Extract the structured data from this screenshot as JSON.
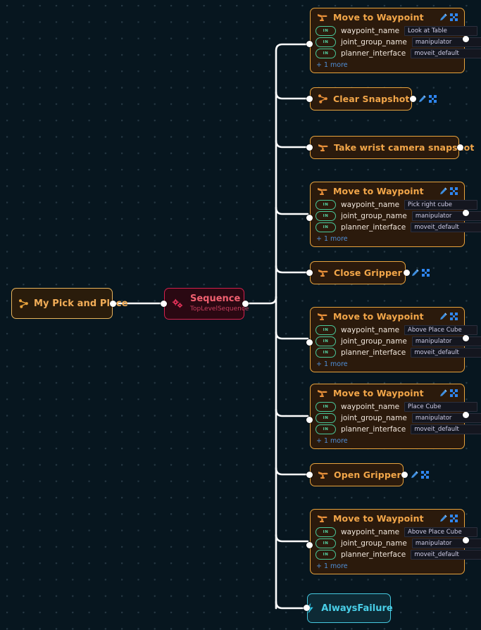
{
  "canvas": {
    "background_color": "#07161f",
    "grid_dot_color": "#96b4c8",
    "edge_color": "#ffffff"
  },
  "icons": {
    "robot_arm": "robot-arm-icon",
    "branch": "branch-node-icon",
    "edit": "pencil-edit-icon",
    "expand": "expand-fullscreen-icon",
    "gears": "double-gear-icon",
    "bolt": "lightning-bolt-icon"
  },
  "port_badge_label": "IN",
  "more_label": "+ 1 more",
  "root": {
    "title": "My Pick and Place",
    "icon": "branch-node-icon",
    "border_color": "#e8b45c"
  },
  "sequence": {
    "title": "Sequence",
    "subtitle": "TopLevelSequence",
    "icon": "double-gear-icon",
    "border_color": "#d4214d"
  },
  "nodes": [
    {
      "id": "move-to-waypoint-look-at-table",
      "type": "action",
      "title": "Move to Waypoint",
      "icon": "robot-arm-icon",
      "ports": [
        {
          "direction": "IN",
          "name": "waypoint_name",
          "value": "Look at Table"
        },
        {
          "direction": "IN",
          "name": "joint_group_name",
          "value": "manipulator"
        },
        {
          "direction": "IN",
          "name": "planner_interface",
          "value": "moveit_default"
        }
      ],
      "more": "+ 1 more"
    },
    {
      "id": "clear-snapshot",
      "type": "action-compact",
      "title": "Clear Snapshot",
      "icon": "branch-node-icon",
      "ports": [],
      "more": null
    },
    {
      "id": "take-wrist-camera-snapshot",
      "type": "action-compact",
      "title": "Take wrist camera snapshot",
      "icon": "robot-arm-icon",
      "ports": [],
      "more": null
    },
    {
      "id": "move-to-waypoint-pick-right-cube",
      "type": "action",
      "title": "Move to Waypoint",
      "icon": "robot-arm-icon",
      "ports": [
        {
          "direction": "IN",
          "name": "waypoint_name",
          "value": "Pick right cube"
        },
        {
          "direction": "IN",
          "name": "joint_group_name",
          "value": "manipulator"
        },
        {
          "direction": "IN",
          "name": "planner_interface",
          "value": "moveit_default"
        }
      ],
      "more": "+ 1 more"
    },
    {
      "id": "close-gripper",
      "type": "action-compact",
      "title": "Close Gripper",
      "icon": "robot-arm-icon",
      "ports": [],
      "more": null
    },
    {
      "id": "move-to-waypoint-above-place-cube-1",
      "type": "action",
      "title": "Move to Waypoint",
      "icon": "robot-arm-icon",
      "ports": [
        {
          "direction": "IN",
          "name": "waypoint_name",
          "value": "Above Place Cube"
        },
        {
          "direction": "IN",
          "name": "joint_group_name",
          "value": "manipulator"
        },
        {
          "direction": "IN",
          "name": "planner_interface",
          "value": "moveit_default"
        }
      ],
      "more": "+ 1 more"
    },
    {
      "id": "move-to-waypoint-place-cube",
      "type": "action",
      "title": "Move to Waypoint",
      "icon": "robot-arm-icon",
      "ports": [
        {
          "direction": "IN",
          "name": "waypoint_name",
          "value": "Place Cube"
        },
        {
          "direction": "IN",
          "name": "joint_group_name",
          "value": "manipulator"
        },
        {
          "direction": "IN",
          "name": "planner_interface",
          "value": "moveit_default"
        }
      ],
      "more": "+ 1 more"
    },
    {
      "id": "open-gripper",
      "type": "action-compact",
      "title": "Open Gripper",
      "icon": "robot-arm-icon",
      "ports": [],
      "more": null
    },
    {
      "id": "move-to-waypoint-above-place-cube-2",
      "type": "action",
      "title": "Move to Waypoint",
      "icon": "robot-arm-icon",
      "ports": [
        {
          "direction": "IN",
          "name": "waypoint_name",
          "value": "Above Place Cube"
        },
        {
          "direction": "IN",
          "name": "joint_group_name",
          "value": "manipulator"
        },
        {
          "direction": "IN",
          "name": "planner_interface",
          "value": "moveit_default"
        }
      ],
      "more": "+ 1 more"
    },
    {
      "id": "always-failure",
      "type": "decorator",
      "title": "AlwaysFailure",
      "icon": "lightning-bolt-icon",
      "ports": [],
      "more": null
    }
  ]
}
